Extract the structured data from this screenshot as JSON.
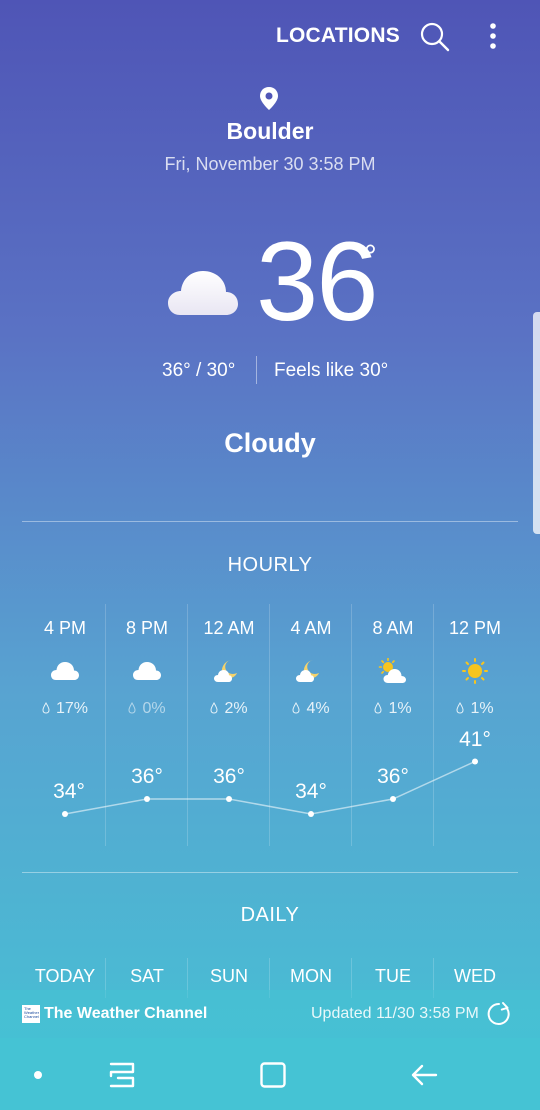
{
  "header": {
    "locations_label": "LOCATIONS",
    "search_icon": "search-icon",
    "more_icon": "more-vert-icon"
  },
  "current": {
    "pin_icon": "location-pin-icon",
    "city": "Boulder",
    "datetime": "Fri, November 30 3:58 PM",
    "icon": "cloudy-icon",
    "temperature": "36",
    "degree_symbol": "°",
    "high_low": "36°  /  30°",
    "feels_like": "Feels like 30°",
    "condition": "Cloudy"
  },
  "hourly": {
    "title": "HOURLY",
    "hours": [
      {
        "time": "4 PM",
        "icon": "cloudy-icon",
        "precip": "17%",
        "temp": 34,
        "temp_label": "34°"
      },
      {
        "time": "8 PM",
        "icon": "cloudy-icon",
        "precip": "0%",
        "temp": 36,
        "temp_label": "36°"
      },
      {
        "time": "12 AM",
        "icon": "moon-cloud-icon",
        "precip": "2%",
        "temp": 36,
        "temp_label": "36°"
      },
      {
        "time": "4 AM",
        "icon": "moon-cloud-icon",
        "precip": "4%",
        "temp": 34,
        "temp_label": "34°"
      },
      {
        "time": "8 AM",
        "icon": "sun-cloud-icon",
        "precip": "1%",
        "temp": 36,
        "temp_label": "36°"
      },
      {
        "time": "12 PM",
        "icon": "sun-icon",
        "precip": "1%",
        "temp": 41,
        "temp_label": "41°"
      }
    ]
  },
  "daily": {
    "title": "DAILY",
    "days": [
      "TODAY",
      "SAT",
      "SUN",
      "MON",
      "TUE",
      "WED"
    ]
  },
  "footer": {
    "provider": "The Weather Channel",
    "updated": "Updated  11/30  3:58 PM",
    "refresh_icon": "refresh-icon"
  },
  "colors": {
    "gradient_top": "#4f55b6",
    "gradient_bottom": "#45c3d4",
    "sun": "#f7c51e",
    "moon": "#f5d36b"
  }
}
